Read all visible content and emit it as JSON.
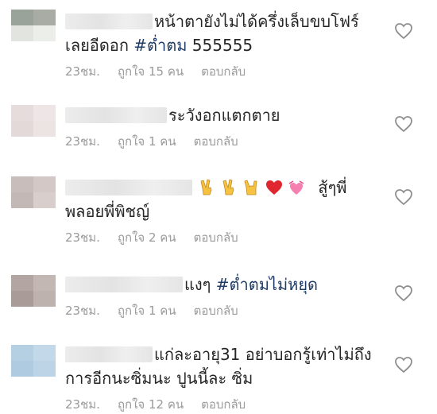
{
  "comments": [
    {
      "text_prefix": "หน้าตายังไม่ได้ครึ่งเล็บขบโฟร์",
      "line2_text": "เลยอีดอก ",
      "hashtag": "#ต่ำตม",
      "line2_suffix": " 555555",
      "time": "23ชม.",
      "likes": "ถูกใจ 15 คน",
      "reply": "ตอบกลับ"
    },
    {
      "text_prefix": "ระวังอกแตกตาย",
      "time": "23ชม.",
      "likes": "ถูกใจ 1 คน",
      "reply": "ตอบกลับ"
    },
    {
      "text_suffix": " สู้ๆพี่",
      "line2_text": "พลอยพี่พิชญ์",
      "emojis": [
        "victory-hand-icon",
        "victory-hand-icon",
        "rock-on-hand-icon",
        "red-heart-icon",
        "heart-with-ribbon-icon"
      ],
      "time": "23ชม.",
      "likes": "ถูกใจ 2 คน",
      "reply": "ตอบกลับ"
    },
    {
      "text_prefix": "แงๆ ",
      "hashtag": "#ต่ำตมไม่หยุด",
      "time": "23ชม.",
      "likes": "ถูกใจ 1 คน",
      "reply": "ตอบกลับ"
    },
    {
      "text_prefix": "แก่ละอายุ31 อย่าบอกรู้เท่าไม่ถึง",
      "line2_text": "การอีกนะซิ่มนะ ปูนนี้ละ ซิ่ม",
      "time": "23ชม.",
      "likes": "ถูกใจ 12 คน",
      "reply": "ตอบกลับ"
    }
  ],
  "colors": {
    "hashtag": "#1f3c66",
    "meta_text": "#9a9a9a",
    "heart_outline": "#8e8e8e"
  }
}
